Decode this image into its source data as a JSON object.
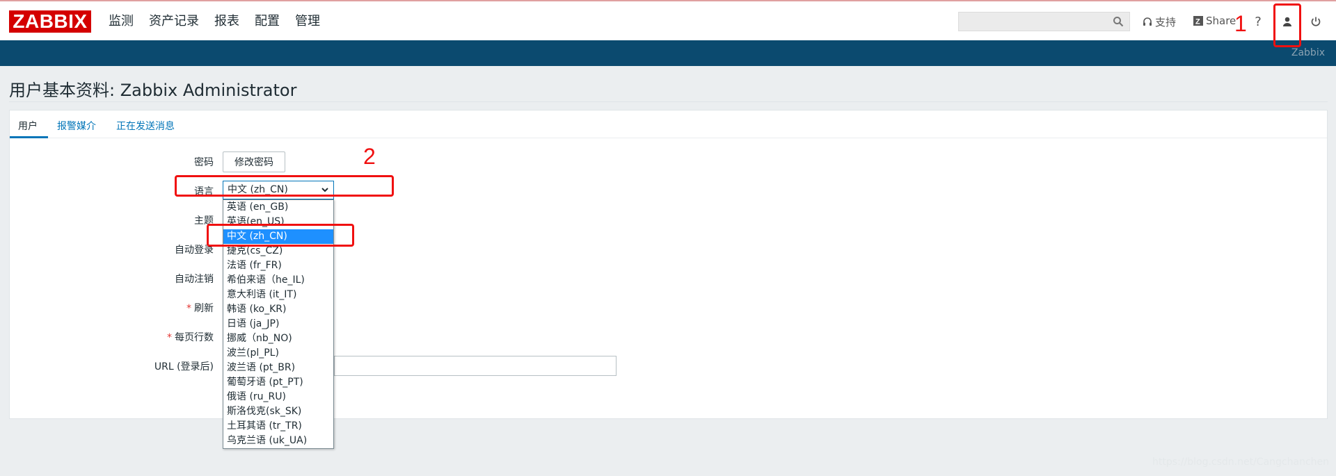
{
  "header": {
    "logo": "ZABBIX",
    "nav": [
      "监测",
      "资产记录",
      "报表",
      "配置",
      "管理"
    ],
    "search_placeholder": "",
    "support_label": "支持",
    "share_label": "Share",
    "help_label": "?"
  },
  "subbar": {
    "right_text": "Zabbix"
  },
  "page": {
    "title": "用户基本资料: Zabbix Administrator"
  },
  "tabs": [
    "用户",
    "报警媒介",
    "正在发送消息"
  ],
  "form": {
    "password_label": "密码",
    "change_password_button": "修改密码",
    "language_label": "语言",
    "language_value": "中文 (zh_CN)",
    "theme_label": "主题",
    "autologin_label": "自动登录",
    "autologout_label": "自动注销",
    "refresh_label": "刷新",
    "rows_per_page_label": "每页行数",
    "url_label": "URL (登录后)",
    "required_mark": "*"
  },
  "language_options": [
    "英语 (en_GB)",
    "英语(en_US)",
    "中文 (zh_CN)",
    "捷克(cs_CZ)",
    "法语 (fr_FR)",
    "希伯来语（he_IL)",
    "意大利语 (it_IT)",
    "韩语 (ko_KR)",
    "日语 (ja_JP)",
    "挪威（nb_NO)",
    "波兰(pl_PL)",
    "波兰语 (pt_BR)",
    "葡萄牙语 (pt_PT)",
    "俄语 (ru_RU)",
    "斯洛伐克(sk_SK)",
    "土耳其语 (tr_TR)",
    "乌克兰语 (uk_UA)"
  ],
  "selected_option_index": 2,
  "annotations": {
    "first": "1",
    "second": "2"
  },
  "watermark": "https://blog.csdn.net/Cangchanchen",
  "colors": {
    "brand": "#d40000",
    "nav_bar": "#0b4a6f",
    "link": "#0275b8",
    "highlight": "#1e90ff",
    "annotation": "#f01010"
  },
  "icons": [
    "search-icon",
    "headset-icon",
    "share-icon",
    "help-icon",
    "user-icon",
    "power-icon",
    "chevron-down-icon"
  ]
}
